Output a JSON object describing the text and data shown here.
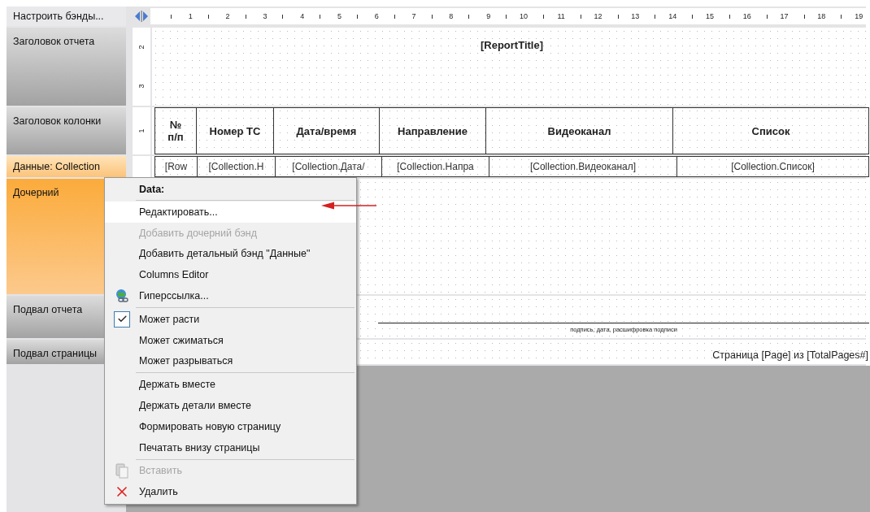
{
  "band_panel": {
    "title": "Настроить бэнды..."
  },
  "ruler": {
    "marks": [
      "1",
      "2",
      "3",
      "4",
      "5",
      "6",
      "7",
      "8",
      "9",
      "10",
      "11",
      "12",
      "13",
      "14",
      "15",
      "16",
      "17",
      "18",
      "19"
    ]
  },
  "bands": [
    {
      "kind": "title",
      "label": "Заголовок отчета",
      "selected": false,
      "ruler_marks": [
        "2",
        "3"
      ],
      "text": "[ReportTitle]"
    },
    {
      "kind": "header",
      "label": "Заголовок колонки",
      "selected": false,
      "ruler_marks": [
        "1"
      ],
      "cells": [
        "№ п/п",
        "Номер ТС",
        "Дата/время",
        "Направление",
        "Видеоканал",
        "Список"
      ]
    },
    {
      "kind": "data",
      "label": "Данные: Collection",
      "selected": true,
      "cells": [
        "[Row",
        "[Collection.Н",
        "[Collection.Дата/",
        "[Collection.Напра",
        "[Collection.Видеоканал]",
        "[Collection.Список]"
      ]
    },
    {
      "kind": "child",
      "label": "Дочерний",
      "selected": true
    },
    {
      "kind": "report_footer",
      "label": "Подвал отчета",
      "selected": false,
      "text": "подпись, дата, расшифровка подписи"
    },
    {
      "kind": "page_footer",
      "label": "Подвал страницы",
      "selected": false,
      "text": "Страница [Page] из [TotalPages#]"
    }
  ],
  "context_menu": {
    "items": [
      {
        "kind": "header",
        "label": "Data:"
      },
      {
        "kind": "separator"
      },
      {
        "kind": "item",
        "label": "Редактировать...",
        "highlighted": true,
        "disabled": false,
        "checked": false
      },
      {
        "kind": "item",
        "label": "Добавить дочерний бэнд",
        "highlighted": false,
        "disabled": true,
        "checked": false
      },
      {
        "kind": "item",
        "label": "Добавить детальный бэнд \"Данные\"",
        "highlighted": false,
        "disabled": false,
        "checked": false
      },
      {
        "kind": "item",
        "label": "Columns Editor",
        "highlighted": false,
        "disabled": false,
        "checked": false
      },
      {
        "kind": "hyperlink",
        "label": "Гиперссылка...",
        "highlighted": false,
        "disabled": false,
        "checked": false
      },
      {
        "kind": "separator"
      },
      {
        "kind": "item",
        "label": "Может расти",
        "highlighted": false,
        "disabled": false,
        "checked": true
      },
      {
        "kind": "item",
        "label": "Может сжиматься",
        "highlighted": false,
        "disabled": false,
        "checked": false
      },
      {
        "kind": "item",
        "label": "Может разрываться",
        "highlighted": false,
        "disabled": false,
        "checked": false
      },
      {
        "kind": "separator"
      },
      {
        "kind": "item",
        "label": "Держать вместе",
        "highlighted": false,
        "disabled": false,
        "checked": false
      },
      {
        "kind": "item",
        "label": "Держать детали вместе",
        "highlighted": false,
        "disabled": false,
        "checked": false
      },
      {
        "kind": "item",
        "label": "Формировать новую страницу",
        "highlighted": false,
        "disabled": false,
        "checked": false
      },
      {
        "kind": "item",
        "label": "Печатать внизу страницы",
        "highlighted": false,
        "disabled": false,
        "checked": false
      },
      {
        "kind": "separator"
      },
      {
        "kind": "paste",
        "label": "Вставить",
        "highlighted": false,
        "disabled": true,
        "checked": false
      },
      {
        "kind": "delete",
        "label": "Удалить",
        "highlighted": false,
        "disabled": false,
        "checked": false
      }
    ]
  }
}
